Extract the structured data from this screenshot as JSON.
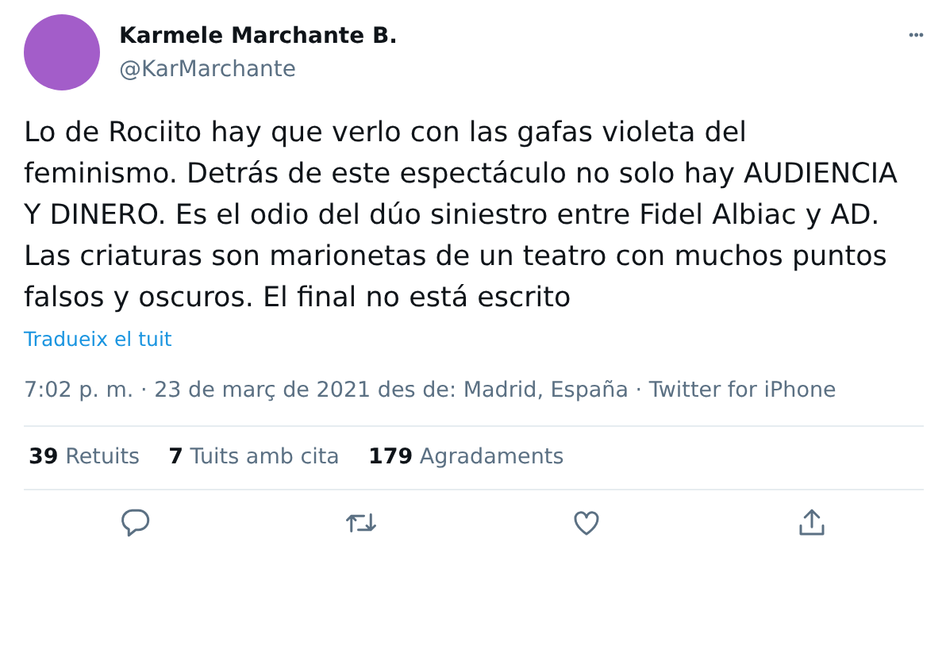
{
  "author": {
    "name": "Karmele Marchante B.",
    "handle": "@KarMarchante"
  },
  "more_button": "•••",
  "text": "Lo de Rociito hay que verlo con las gafas violeta del feminismo. Detrás de este espectáculo no solo hay AUDIENCIA Y DINERO. Es el odio del dúo siniestro entre Fidel Albiac y AD. Las criaturas son marionetas de un teatro con muchos puntos falsos y oscuros. El final no está escrito",
  "translate_link": "Tradueix el tuit",
  "meta": "7:02 p. m. · 23 de març de 2021 des de: Madrid, España · Twitter for iPhone",
  "stats": [
    {
      "count": "39",
      "label": "Retuits"
    },
    {
      "count": "7",
      "label": "Tuits amb cita"
    },
    {
      "count": "179",
      "label": "Agradaments"
    }
  ],
  "actions": [
    {
      "kind": "reply"
    },
    {
      "kind": "retweet"
    },
    {
      "kind": "like"
    },
    {
      "kind": "share"
    }
  ]
}
